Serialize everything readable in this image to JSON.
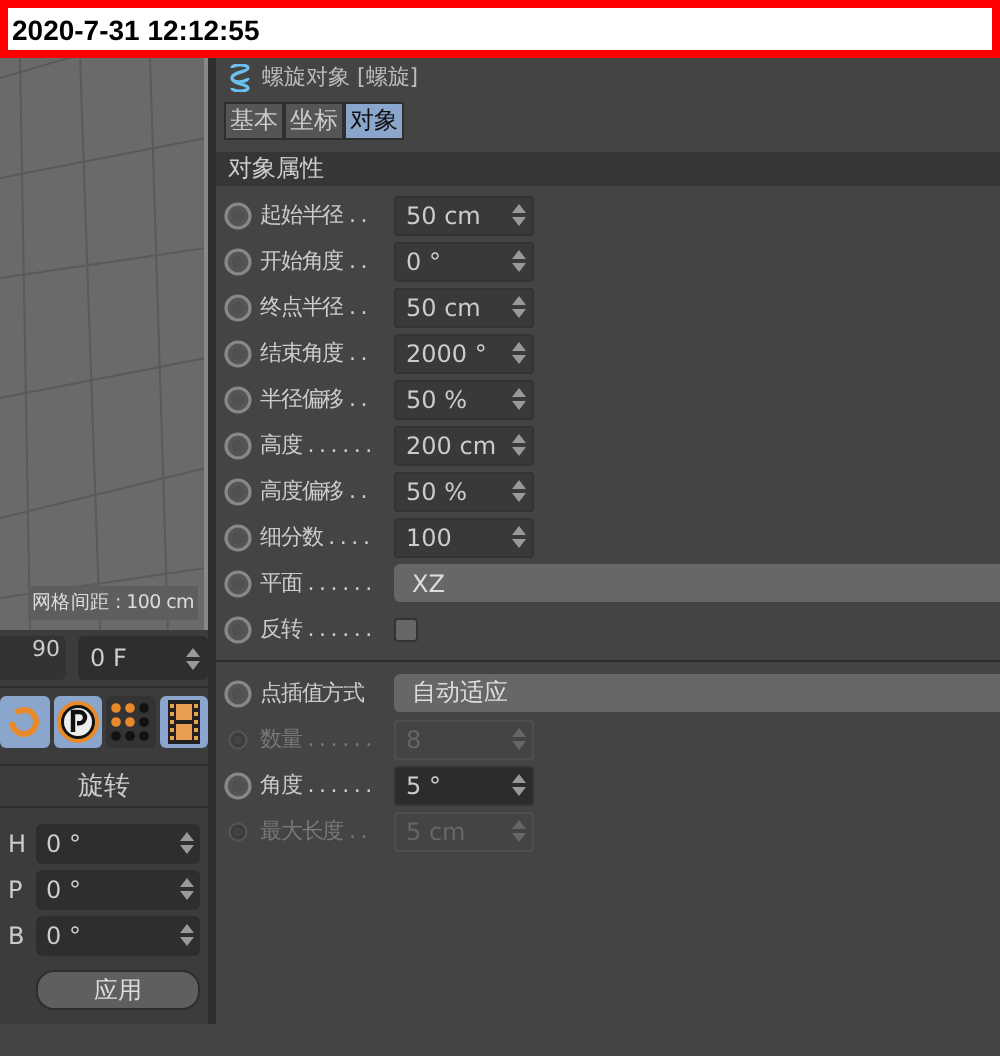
{
  "timestamp": "2020-7-31 12:12:55",
  "viewport": {
    "grid_label": "网格间距 : 100 cm"
  },
  "timeline": {
    "tick_label": "90",
    "frame_field": "0 F"
  },
  "toolbar": [
    {
      "kind": "rotate",
      "selected": true
    },
    {
      "kind": "parking",
      "selected": true
    },
    {
      "kind": "dots",
      "selected": false
    },
    {
      "kind": "film",
      "selected": true
    }
  ],
  "rotation": {
    "title": "旋转",
    "fields": [
      {
        "axis": "H",
        "value": "0 °"
      },
      {
        "axis": "P",
        "value": "0 °"
      },
      {
        "axis": "B",
        "value": "0 °"
      }
    ],
    "apply_button": "应用"
  },
  "object": {
    "title": "螺旋对象 [螺旋]",
    "tabs": [
      {
        "label": "基本",
        "selected": false
      },
      {
        "label": "坐标",
        "selected": false
      },
      {
        "label": "对象",
        "selected": true
      }
    ],
    "section": "对象属性",
    "groups": [
      [
        {
          "kind": "number",
          "label": "起始半径 . .",
          "value": "50 cm",
          "disabled": false,
          "focused": false
        },
        {
          "kind": "number",
          "label": "开始角度 . .",
          "value": "0 °",
          "disabled": false,
          "focused": false
        },
        {
          "kind": "number",
          "label": "终点半径 . .",
          "value": "50 cm",
          "disabled": false,
          "focused": false
        },
        {
          "kind": "number",
          "label": "结束角度 . .",
          "value": "2000 °",
          "disabled": false,
          "focused": false
        },
        {
          "kind": "number",
          "label": "半径偏移 . .",
          "value": "50 %",
          "disabled": false,
          "focused": false
        },
        {
          "kind": "number",
          "label": "高度 . . . . . .",
          "value": "200 cm",
          "disabled": false,
          "focused": false
        },
        {
          "kind": "number",
          "label": "高度偏移 . .",
          "value": "50 %",
          "disabled": false,
          "focused": false
        },
        {
          "kind": "number",
          "label": "细分数 . . . .",
          "value": "100",
          "disabled": false,
          "focused": false
        },
        {
          "kind": "dropdown",
          "label": "平面 . . . . . .",
          "value": "XZ",
          "disabled": false
        },
        {
          "kind": "checkbox",
          "label": "反转 . . . . . .",
          "checked": false,
          "disabled": false
        }
      ],
      [
        {
          "kind": "dropdown",
          "label": "点插值方式",
          "value": "自动适应",
          "disabled": false
        },
        {
          "kind": "number",
          "label": "数量 . . . . . .",
          "value": "8",
          "disabled": true,
          "focused": false
        },
        {
          "kind": "number",
          "label": "角度 . . . . . .",
          "value": "5 °",
          "disabled": false,
          "focused": true
        },
        {
          "kind": "number",
          "label": "最大长度 . .",
          "value": "5 cm",
          "disabled": true,
          "focused": false
        }
      ]
    ]
  }
}
